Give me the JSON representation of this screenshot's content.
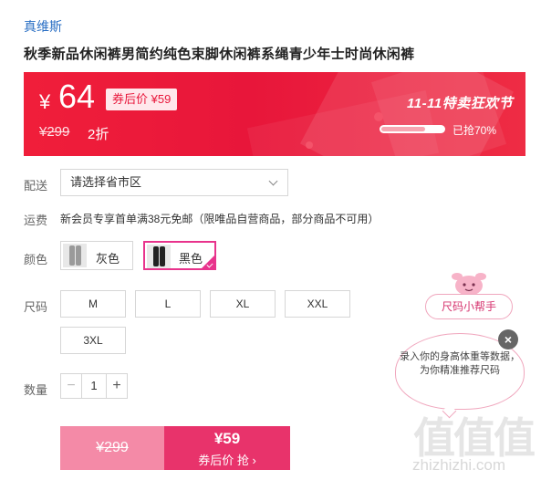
{
  "product": {
    "brand": "真维斯",
    "title": "秋季新品休闲裤男简约纯色束脚休闲裤系绳青少年士时尚休闲裤"
  },
  "promo": {
    "currency": "¥",
    "price": "64",
    "after_coupon": "券后价 ¥59",
    "original_price": "¥299",
    "discount": "2折",
    "event_name": "11-11特卖狂欢节",
    "sold_text": "已抢70%",
    "sold_progress": 0.7,
    "accent_color": "#e8163a"
  },
  "options": {
    "delivery_label": "配送",
    "delivery_placeholder": "请选择省市区",
    "shipping_label": "运费",
    "shipping_text": "新会员专享首单满38元免邮（限唯品自营商品，部分商品不可用）",
    "color_label": "颜色",
    "colors": [
      {
        "name": "灰色",
        "selected": false
      },
      {
        "name": "黑色",
        "selected": true
      }
    ],
    "size_label": "尺码",
    "sizes": [
      "M",
      "L",
      "XL",
      "XXL",
      "3XL"
    ],
    "qty_label": "数量",
    "qty_minus": "−",
    "qty_value": "1",
    "qty_plus": "+"
  },
  "buy": {
    "original_price": "¥299",
    "coupon_price": "¥59",
    "buy_label": "券后价 抢 ›"
  },
  "size_helper": {
    "button_label": "尺码小帮手",
    "bubble_text": "录入你的身高体重等数据，为你精准推荐尺码",
    "close": "×"
  },
  "watermark": {
    "logo": "值值值",
    "url": "zhizhizhi.com"
  }
}
